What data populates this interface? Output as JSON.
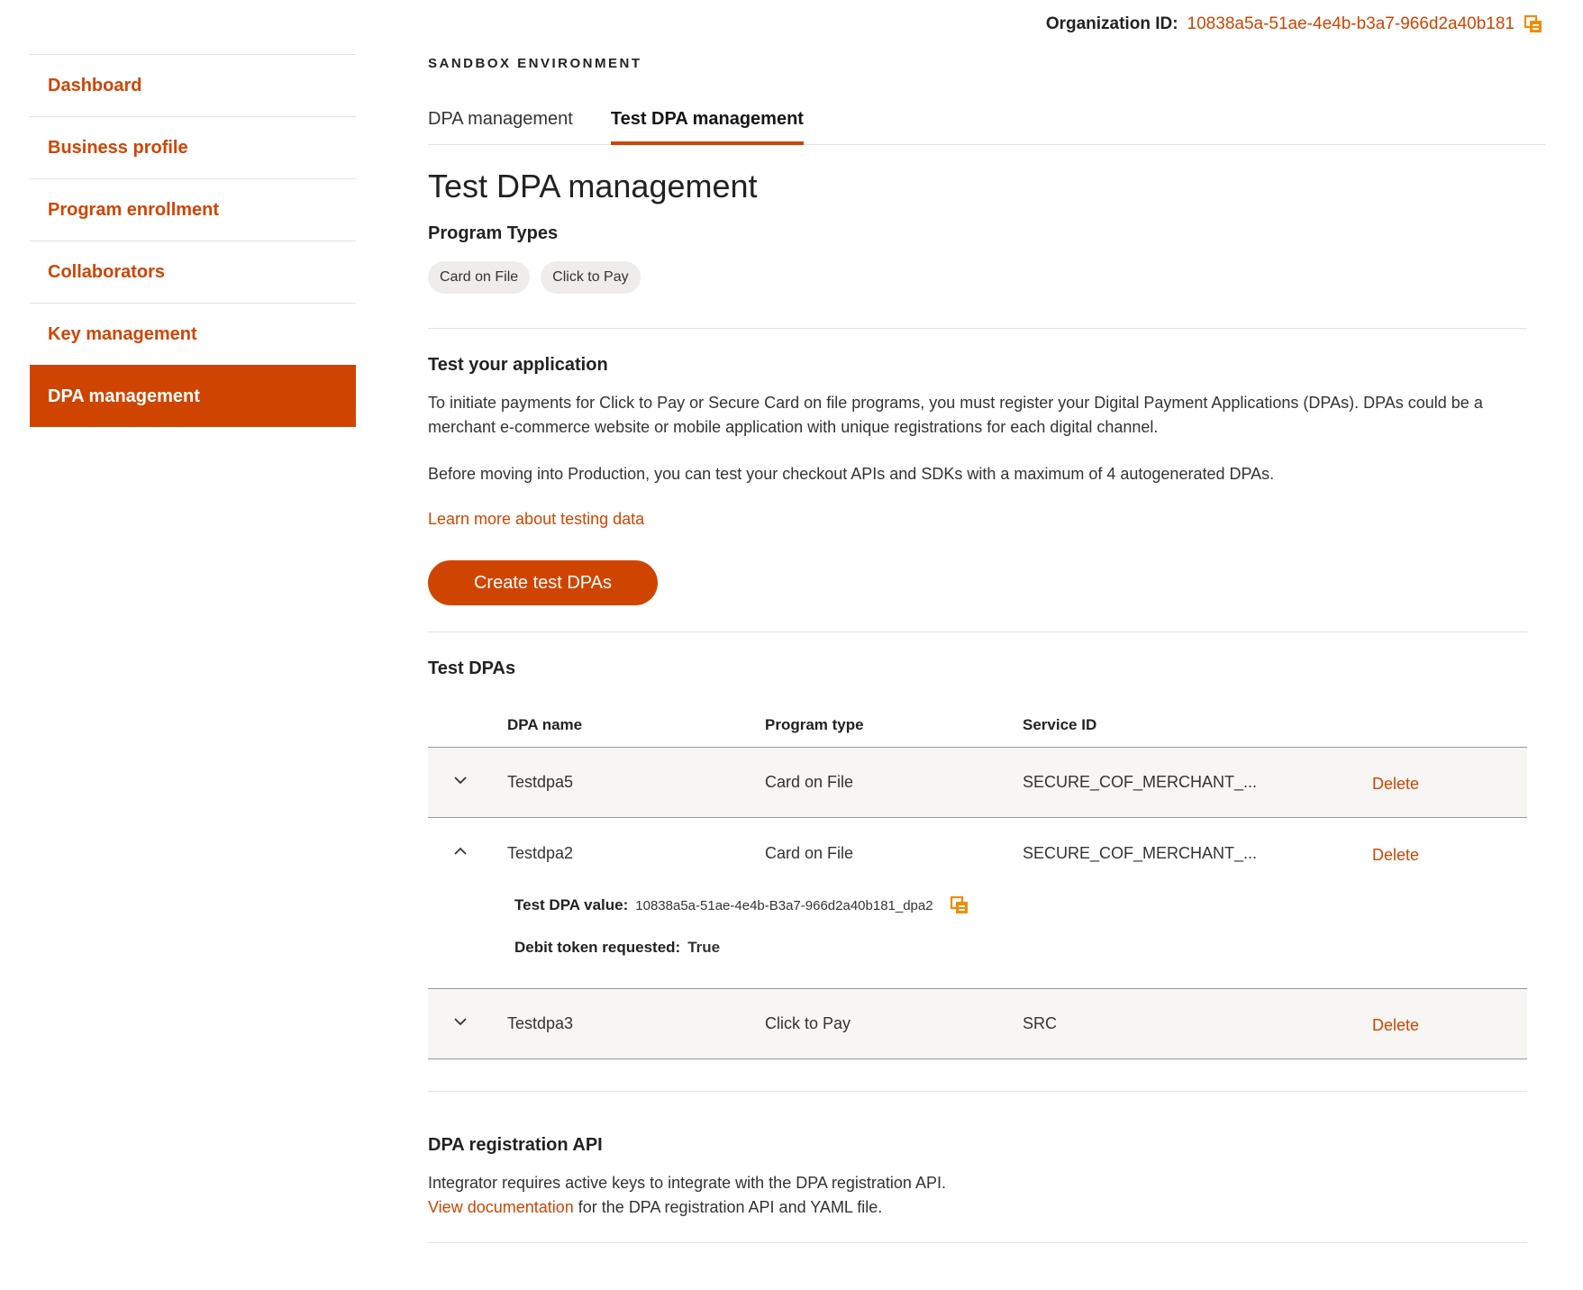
{
  "org": {
    "label": "Organization ID:",
    "value": "10838a5a-51ae-4e4b-b3a7-966d2a40b181",
    "copy_icon": "copy-icon"
  },
  "sidebar": {
    "items": [
      {
        "label": "Dashboard",
        "active": false
      },
      {
        "label": "Business profile",
        "active": false
      },
      {
        "label": "Program enrollment",
        "active": false
      },
      {
        "label": "Collaborators",
        "active": false
      },
      {
        "label": "Key management",
        "active": false
      },
      {
        "label": "DPA management",
        "active": true
      }
    ]
  },
  "header": {
    "environment": "SANDBOX ENVIRONMENT",
    "tabs": [
      {
        "label": "DPA management",
        "active": false
      },
      {
        "label": "Test DPA management",
        "active": true
      }
    ]
  },
  "main": {
    "title": "Test DPA management",
    "program_types_title": "Program Types",
    "program_types": [
      "Card on File",
      "Click to Pay"
    ],
    "test_app": {
      "title": "Test your application",
      "para1": "To initiate payments for Click to Pay or Secure Card on file programs, you must register your Digital Payment Applications (DPAs). DPAs could be a merchant e-commerce website or mobile application with unique registrations for each digital channel.",
      "para2": "Before moving into Production, you can test your checkout APIs and SDKs with a maximum of 4 autogenerated DPAs.",
      "learn_link": "Learn more about testing data",
      "create_button": "Create test DPAs"
    },
    "test_dpas": {
      "title": "Test DPAs",
      "columns": [
        "DPA name",
        "Program type",
        "Service ID"
      ],
      "rows": [
        {
          "name": "Testdpa5",
          "program_type": "Card on File",
          "service_id": "SECURE_COF_MERCHANT_...",
          "action": "Delete",
          "expanded": false
        },
        {
          "name": "Testdpa2",
          "program_type": "Card on File",
          "service_id": "SECURE_COF_MERCHANT_...",
          "action": "Delete",
          "expanded": true
        },
        {
          "name": "Testdpa3",
          "program_type": "Click to Pay",
          "service_id": "SRC",
          "action": "Delete",
          "expanded": false
        }
      ],
      "expanded_detail": {
        "dpa_value_label": "Test DPA value:",
        "dpa_value": "10838a5a-51ae-4e4b-B3a7-966d2a40b181_dpa2",
        "debit_label": "Debit token requested:",
        "debit_value": "True"
      }
    },
    "api": {
      "title": "DPA registration API",
      "line1": "Integrator requires active keys to integrate with the DPA registration API.",
      "link": "View documentation",
      "line2_rest": " for the DPA registration API and YAML file."
    }
  },
  "colors": {
    "accent": "#cf4500",
    "divider": "#e4e2de",
    "chip_bg": "#eeedeb",
    "row_shade": "#f7f6f4"
  }
}
